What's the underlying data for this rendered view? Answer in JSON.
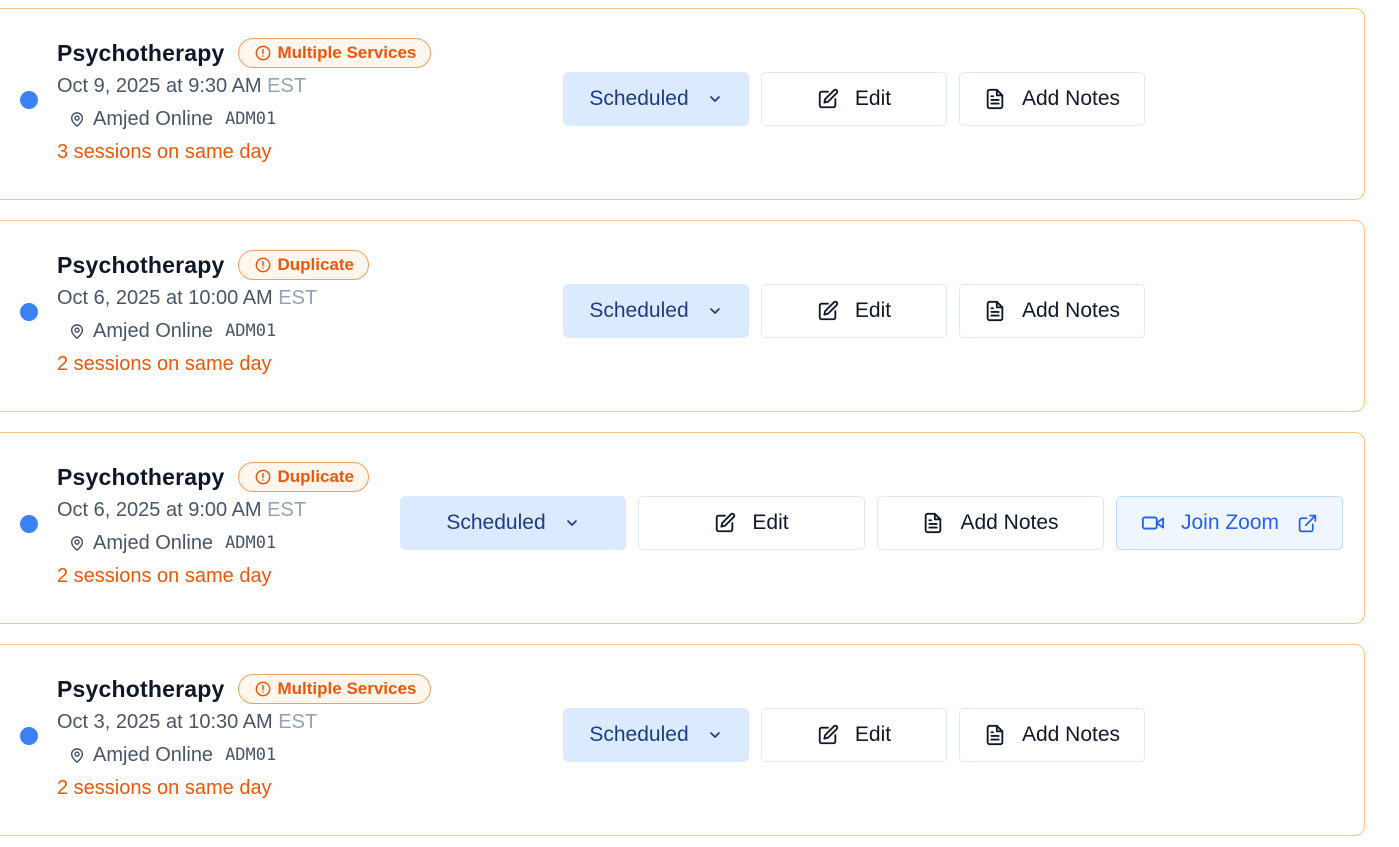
{
  "appointments": [
    {
      "title": "Psychotherapy",
      "badge": "Multiple Services",
      "date": "Oct 9, 2025 at 9:30 AM",
      "timezone": "EST",
      "location": "Amjed Online",
      "location_code": "ADM01",
      "sessions_note": "3 sessions on same day",
      "status_label": "Scheduled",
      "edit_label": "Edit",
      "notes_label": "Add Notes"
    },
    {
      "title": "Psychotherapy",
      "badge": "Duplicate",
      "date": "Oct 6, 2025 at 10:00 AM",
      "timezone": "EST",
      "location": "Amjed Online",
      "location_code": "ADM01",
      "sessions_note": "2 sessions on same day",
      "status_label": "Scheduled",
      "edit_label": "Edit",
      "notes_label": "Add Notes"
    },
    {
      "title": "Psychotherapy",
      "badge": "Duplicate",
      "date": "Oct 6, 2025 at 9:00 AM",
      "timezone": "EST",
      "location": "Amjed Online",
      "location_code": "ADM01",
      "sessions_note": "2 sessions on same day",
      "status_label": "Scheduled",
      "edit_label": "Edit",
      "notes_label": "Add Notes",
      "zoom_label": "Join Zoom"
    },
    {
      "title": "Psychotherapy",
      "badge": "Multiple Services",
      "date": "Oct 3, 2025 at 10:30 AM",
      "timezone": "EST",
      "location": "Amjed Online",
      "location_code": "ADM01",
      "sessions_note": "2 sessions on same day",
      "status_label": "Scheduled",
      "edit_label": "Edit",
      "notes_label": "Add Notes"
    }
  ],
  "colors": {
    "card_border": "#f5c483",
    "status_dot": "#3b82f6",
    "warning": "#ea580c",
    "status_bg": "#dbeafe",
    "zoom_text": "#2563eb"
  },
  "icons": {
    "badge": "alert-circle-icon",
    "location": "map-pin-icon",
    "status": "chevron-down-icon",
    "edit": "edit-icon",
    "notes": "file-text-icon",
    "zoom": "video-icon",
    "zoom_external": "external-link-icon"
  }
}
